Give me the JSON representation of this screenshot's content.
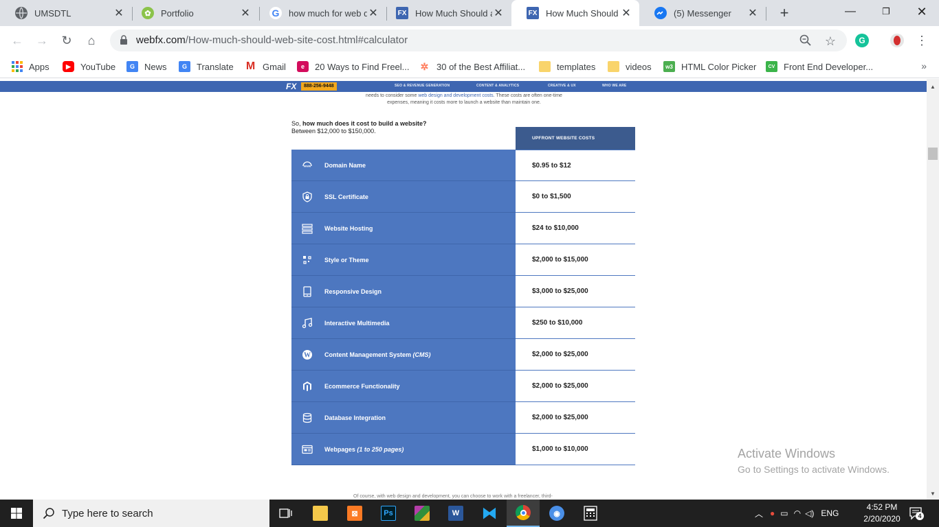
{
  "browser": {
    "tabs": [
      {
        "title": "UMSDTL",
        "icon": "globe-icon",
        "active": false
      },
      {
        "title": "Portfolio",
        "icon": "portfolio-icon",
        "active": false
      },
      {
        "title": "how much for web d",
        "icon": "google-icon",
        "active": false
      },
      {
        "title": "How Much Should a",
        "icon": "webfx-icon",
        "active": false
      },
      {
        "title": "How Much Should a",
        "icon": "webfx-icon",
        "active": true
      },
      {
        "title": "(5) Messenger",
        "icon": "messenger-icon",
        "active": false
      }
    ],
    "new_tab_label": "+",
    "url_host": "webfx.com",
    "url_path": "/How-much-should-web-site-cost.html#calculator",
    "bookmarks": [
      {
        "label": "Apps",
        "icon": "apps-grid-icon"
      },
      {
        "label": "YouTube",
        "icon": "youtube-icon"
      },
      {
        "label": "News",
        "icon": "google-news-icon"
      },
      {
        "label": "Translate",
        "icon": "google-translate-icon"
      },
      {
        "label": "Gmail",
        "icon": "gmail-icon"
      },
      {
        "label": "20 Ways to Find Freel...",
        "icon": "elementor-icon"
      },
      {
        "label": "30 of the Best Affiliat...",
        "icon": "hubspot-icon"
      },
      {
        "label": "templates",
        "icon": "folder-icon"
      },
      {
        "label": "videos",
        "icon": "folder-icon"
      },
      {
        "label": "HTML Color Picker",
        "icon": "w3schools-icon"
      },
      {
        "label": "Front End Developer...",
        "icon": "bookmark-site-icon"
      }
    ],
    "bookmarks_more": "»"
  },
  "site": {
    "logo": "FX",
    "phone": "888-256-9448",
    "nav": [
      "SEO & REVENUE GENERATION",
      "CONTENT & ANALYTICS",
      "CREATIVE & UX",
      "WHO WE ARE"
    ],
    "intro_line1_pre": "needs to consider some ",
    "intro_line1_link": "web design and development costs",
    "intro_line1_post": ". These costs are often one-time",
    "intro_line2": "expenses, meaning it costs more to launch a website than maintain one.",
    "question_pre": "So, ",
    "question_bold": "how much does it cost to build a website?",
    "answer": "Between $12,000 to $150,000.",
    "table_header": "UPFRONT WEBSITE COSTS",
    "rows": [
      {
        "label": "Domain Name",
        "label_italic": "",
        "value": "$0.95 to $12",
        "icon": "www-icon"
      },
      {
        "label": "SSL Certificate",
        "label_italic": "",
        "value": "$0 to $1,500",
        "icon": "shield-lock-icon"
      },
      {
        "label": "Website Hosting",
        "label_italic": "",
        "value": "$24 to $10,000",
        "icon": "server-icon"
      },
      {
        "label": "Style or Theme",
        "label_italic": "",
        "value": "$2,000 to $15,000",
        "icon": "theme-grid-icon"
      },
      {
        "label": "Responsive Design",
        "label_italic": "",
        "value": "$3,000 to $25,000",
        "icon": "tablet-icon"
      },
      {
        "label": "Interactive Multimedia",
        "label_italic": "",
        "value": "$250 to $10,000",
        "icon": "music-note-icon"
      },
      {
        "label": "Content Management System ",
        "label_italic": "(CMS)",
        "value": "$2,000 to $25,000",
        "icon": "wordpress-icon"
      },
      {
        "label": "Ecommerce Functionality",
        "label_italic": "",
        "value": "$2,000 to $25,000",
        "icon": "magento-icon"
      },
      {
        "label": "Database Integration",
        "label_italic": "",
        "value": "$2,000 to $25,000",
        "icon": "database-icon"
      },
      {
        "label": "Webpages ",
        "label_italic": "(1 to 250 pages)",
        "value": "$1,000 to $10,000",
        "icon": "webpage-icon"
      }
    ],
    "footnote": "Of course, with web design and development, you can choose to work with a freelancer, third-"
  },
  "watermark": {
    "line1": "Activate Windows",
    "line2": "Go to Settings to activate Windows."
  },
  "taskbar": {
    "search_placeholder": "Type here to search",
    "language": "ENG",
    "time": "4:52 PM",
    "date": "2/20/2020",
    "notification_count": "4",
    "accent": "#76b9ed"
  },
  "colors": {
    "site_blue": "#4d77c0",
    "header_blue": "#3c5b8e",
    "nav_blue": "#3e66b1",
    "phone_orange": "#f2a81d"
  }
}
